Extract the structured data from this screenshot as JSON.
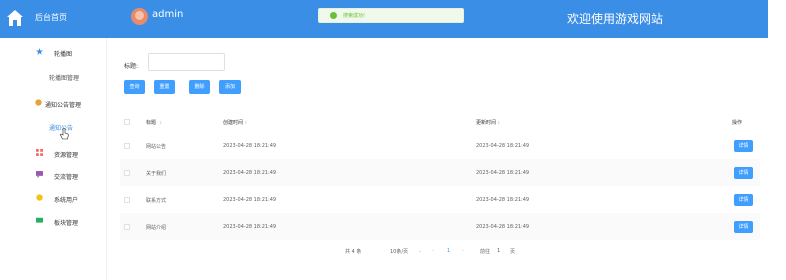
{
  "header": {
    "home_label": "后台首页",
    "admin_name": "admin",
    "welcome": "欢迎使用游戏网站",
    "bg_color": "#3a8ee6"
  },
  "toast": {
    "text": "搜索成功!",
    "icon": "success-check-icon"
  },
  "sidebar": {
    "sections": [
      {
        "label": "轮播图",
        "icon": "star-icon",
        "sub": "轮播图管理"
      },
      {
        "label": "通知公告管理",
        "icon": "circle-icon",
        "sub": "通知公告"
      },
      {
        "label": "资源管理",
        "icon": "grid-icon"
      },
      {
        "label": "交流管理",
        "icon": "chat-icon"
      },
      {
        "label": "系统用户",
        "icon": "circle-icon"
      },
      {
        "label": "板块管理",
        "icon": "board-icon"
      }
    ]
  },
  "search": {
    "title_label": "标题:",
    "title_value": "",
    "buttons": [
      "查询",
      "重置",
      "删除",
      "添加"
    ]
  },
  "table": {
    "headers": [
      "标题",
      "创建时间",
      "更新时间",
      "操作"
    ],
    "rows": [
      {
        "title": "网站公告",
        "created": "2023-04-28 18:21:49",
        "updated": "2023-04-28 18:21:49",
        "action": "详情"
      },
      {
        "title": "关于我们",
        "created": "2023-04-28 18:21:49",
        "updated": "2023-04-28 18:21:49",
        "action": "详情"
      },
      {
        "title": "联系方式",
        "created": "2023-04-28 18:21:49",
        "updated": "2023-04-28 18:21:49",
        "action": "详情"
      },
      {
        "title": "网站介绍",
        "created": "2023-04-28 18:21:49",
        "updated": "2023-04-28 18:21:49",
        "action": "详情"
      }
    ]
  },
  "pagination": {
    "total": "共 4 条",
    "page_size": "10条/页",
    "current_page": "1",
    "goto_label": "前往",
    "goto_value": "1",
    "page_unit": "页"
  }
}
